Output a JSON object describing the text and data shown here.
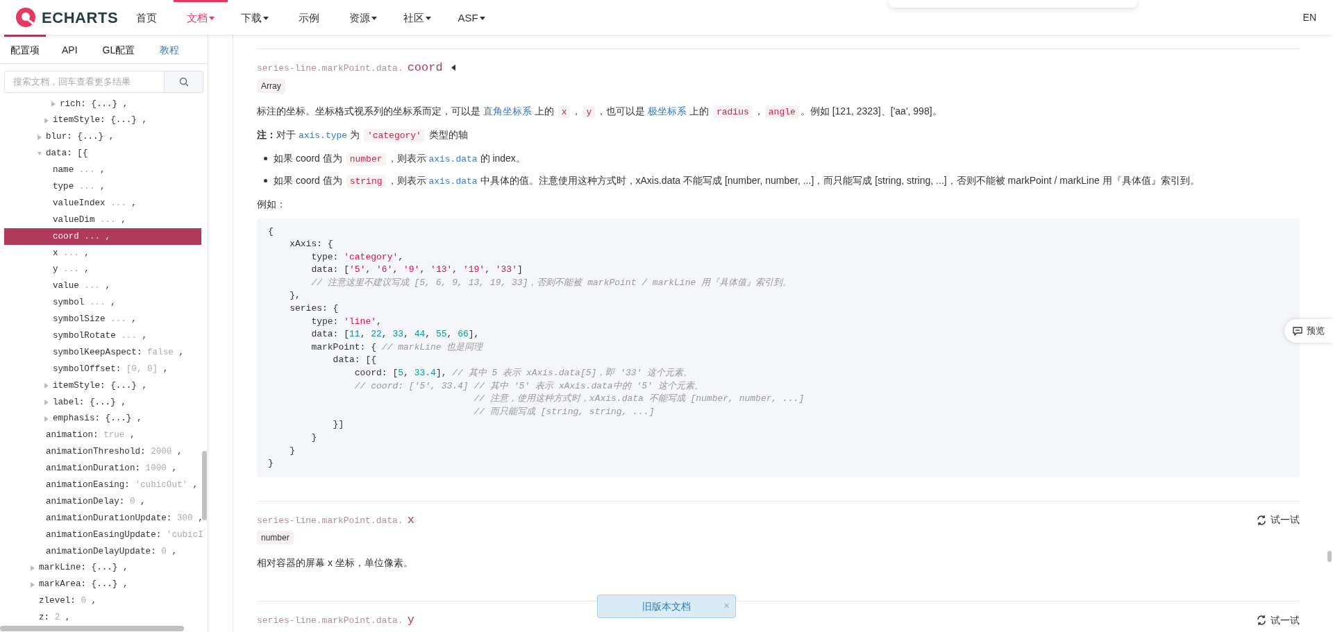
{
  "header": {
    "logo_text": "ECHARTS",
    "nav": [
      {
        "label": "首页",
        "selected": false,
        "has_menu": false
      },
      {
        "label": "文档",
        "selected": true,
        "has_menu": true
      },
      {
        "label": "下载",
        "selected": false,
        "has_menu": true
      },
      {
        "label": "示例",
        "selected": false,
        "has_menu": false
      },
      {
        "label": "资源",
        "selected": false,
        "has_menu": true
      },
      {
        "label": "社区",
        "selected": false,
        "has_menu": true
      },
      {
        "label": "ASF",
        "selected": false,
        "has_menu": true
      }
    ],
    "language": "EN"
  },
  "sidebar": {
    "tabs": [
      {
        "label": "配置项",
        "selected": true,
        "kind": "tab"
      },
      {
        "label": "API",
        "selected": false,
        "kind": "tab"
      },
      {
        "label": "GL配置",
        "selected": false,
        "kind": "tab"
      },
      {
        "label": "教程",
        "selected": false,
        "kind": "link"
      }
    ],
    "search": {
      "placeholder": "搜索文档，回车查看更多结果"
    },
    "tree": [
      {
        "kind": "hidden",
        "children": [
          {
            "kind": "hidden",
            "children": [
              {
                "kind": "hidden",
                "children": [
                  {
                    "kind": "node",
                    "key": "rich:",
                    "value": "{...}",
                    "value_muted": false,
                    "punct": ",",
                    "expanded": false,
                    "selected": false
                  }
                ]
              },
              {
                "kind": "node",
                "key": "itemStyle:",
                "value": "{...}",
                "value_muted": false,
                "punct": ",",
                "expanded": false,
                "selected": false
              }
            ]
          },
          {
            "kind": "node",
            "key": "blur:",
            "value": "{...}",
            "value_muted": false,
            "punct": ",",
            "expanded": false,
            "selected": false
          },
          {
            "kind": "node",
            "key": "data:",
            "value": "[{",
            "value_muted": false,
            "expanded": true,
            "selected": false,
            "children": [
              {
                "kind": "leaf",
                "key": "name",
                "value": "...",
                "value_muted": true,
                "punct": ",",
                "selected": false
              },
              {
                "kind": "leaf",
                "key": "type",
                "value": "...",
                "value_muted": true,
                "punct": ",",
                "selected": false
              },
              {
                "kind": "leaf",
                "key": "valueIndex",
                "value": "...",
                "value_muted": true,
                "punct": ",",
                "selected": false
              },
              {
                "kind": "leaf",
                "key": "valueDim",
                "value": "...",
                "value_muted": true,
                "punct": ",",
                "selected": false
              },
              {
                "kind": "leaf",
                "key": "coord",
                "value": "...",
                "value_muted": true,
                "punct": ",",
                "selected": true
              },
              {
                "kind": "leaf",
                "key": "x",
                "value": "...",
                "value_muted": true,
                "punct": ",",
                "selected": false
              },
              {
                "kind": "leaf",
                "key": "y",
                "value": "...",
                "value_muted": true,
                "punct": ",",
                "selected": false
              },
              {
                "kind": "leaf",
                "key": "value",
                "value": "...",
                "value_muted": true,
                "punct": ",",
                "selected": false
              },
              {
                "kind": "leaf",
                "key": "symbol",
                "value": "...",
                "value_muted": true,
                "punct": ",",
                "selected": false
              },
              {
                "kind": "leaf",
                "key": "symbolSize",
                "value": "...",
                "value_muted": true,
                "punct": ",",
                "selected": false
              },
              {
                "kind": "leaf",
                "key": "symbolRotate",
                "value": "...",
                "value_muted": true,
                "punct": ",",
                "selected": false
              },
              {
                "kind": "leaf",
                "key": "symbolKeepAspect:",
                "value": "false",
                "value_muted": true,
                "punct": ",",
                "selected": false
              },
              {
                "kind": "leaf",
                "key": "symbolOffset:",
                "value": "[0, 0]",
                "value_muted": true,
                "punct": ",",
                "selected": false
              },
              {
                "kind": "node",
                "key": "itemStyle:",
                "value": "{...}",
                "value_muted": false,
                "punct": ",",
                "expanded": false,
                "selected": false
              },
              {
                "kind": "node",
                "key": "label:",
                "value": "{...}",
                "value_muted": false,
                "punct": ",",
                "expanded": false,
                "selected": false
              },
              {
                "kind": "node",
                "key": "emphasis:",
                "value": "{...}",
                "value_muted": false,
                "punct": ",",
                "expanded": false,
                "selected": false
              }
            ]
          },
          {
            "kind": "leaf",
            "key": "animation:",
            "value": "true",
            "value_muted": true,
            "punct": ",",
            "selected": false
          },
          {
            "kind": "leaf",
            "key": "animationThreshold:",
            "value": "2000",
            "value_muted": true,
            "punct": ",",
            "selected": false
          },
          {
            "kind": "leaf",
            "key": "animationDuration:",
            "value": "1000",
            "value_muted": true,
            "punct": ",",
            "selected": false
          },
          {
            "kind": "leaf",
            "key": "animationEasing:",
            "value": "'cubicOut'",
            "value_muted": true,
            "punct": ",",
            "selected": false
          },
          {
            "kind": "leaf",
            "key": "animationDelay:",
            "value": "0",
            "value_muted": true,
            "punct": ",",
            "selected": false
          },
          {
            "kind": "leaf",
            "key": "animationDurationUpdate:",
            "value": "300",
            "value_muted": true,
            "punct": ",",
            "selected": false
          },
          {
            "kind": "leaf",
            "key": "animationEasingUpdate:",
            "value": "'cubicI",
            "value_muted": true,
            "selected": false
          },
          {
            "kind": "leaf",
            "key": "animationDelayUpdate:",
            "value": "0",
            "value_muted": true,
            "punct": ",",
            "selected": false
          }
        ]
      },
      {
        "kind": "node",
        "key": "markLine:",
        "value": "{...}",
        "value_muted": false,
        "punct": ",",
        "expanded": false,
        "selected": false
      },
      {
        "kind": "node",
        "key": "markArea:",
        "value": "{...}",
        "value_muted": false,
        "punct": ",",
        "expanded": false,
        "selected": false
      },
      {
        "kind": "leaf",
        "key": "zlevel:",
        "value": "0",
        "value_muted": true,
        "punct": ",",
        "selected": false
      },
      {
        "kind": "leaf",
        "key": "z:",
        "value": "2",
        "value_muted": true,
        "punct": ",",
        "selected": false
      }
    ]
  },
  "sections": [
    {
      "path": "series-line.markPoint.data.",
      "name": "coord",
      "toggle": true,
      "type": "Array",
      "blocks": [
        {
          "kind": "paragraph",
          "segments": [
            {
              "kind": "text",
              "text": "标注的坐标。坐标格式视系列的坐标系而定，可以是 "
            },
            {
              "kind": "link",
              "text": "直角坐标系"
            },
            {
              "kind": "text",
              "text": " 上的 "
            },
            {
              "kind": "code",
              "text": "x"
            },
            {
              "kind": "text",
              "text": "，"
            },
            {
              "kind": "code",
              "text": "y"
            },
            {
              "kind": "text",
              "text": "，也可以是 "
            },
            {
              "kind": "link",
              "text": "极坐标系"
            },
            {
              "kind": "text",
              "text": " 上的 "
            },
            {
              "kind": "code",
              "text": "radius"
            },
            {
              "kind": "text",
              "text": "，"
            },
            {
              "kind": "code",
              "text": "angle"
            },
            {
              "kind": "text",
              "text": "。例如 [121, 2323]、['aa', 998]。"
            }
          ]
        },
        {
          "kind": "paragraph",
          "segments": [
            {
              "kind": "bold",
              "text": "注："
            },
            {
              "kind": "text",
              "text": "对于 "
            },
            {
              "kind": "code_link",
              "text": "axis.type"
            },
            {
              "kind": "text",
              "text": " 为 "
            },
            {
              "kind": "code",
              "text": "'category'"
            },
            {
              "kind": "text",
              "text": " 类型的轴"
            }
          ]
        },
        {
          "kind": "bullets",
          "items": [
            [
              {
                "kind": "text",
                "text": "如果 coord 值为 "
              },
              {
                "kind": "code",
                "text": "number"
              },
              {
                "kind": "text",
                "text": "，则表示 "
              },
              {
                "kind": "code_link",
                "text": "axis.data"
              },
              {
                "kind": "text",
                "text": " 的 index。"
              }
            ],
            [
              {
                "kind": "text",
                "text": "如果 coord 值为 "
              },
              {
                "kind": "code",
                "text": "string"
              },
              {
                "kind": "text",
                "text": "，则表示 "
              },
              {
                "kind": "code_link",
                "text": "axis.data"
              },
              {
                "kind": "text",
                "text": " 中具体的值。注意使用这种方式时，xAxis.data 不能写成 [number, number, ...]，而只能写成 [string, string, ...]，否则不能被 markPoint / markLine 用『具体值』索引到。"
              }
            ]
          ]
        },
        {
          "kind": "paragraph",
          "segments": [
            {
              "kind": "text",
              "text": "例如："
            }
          ]
        },
        {
          "kind": "code",
          "lines": [
            [
              {
                "kind": "plain",
                "text": "{"
              }
            ],
            [
              {
                "kind": "plain",
                "text": "    xAxis: {"
              }
            ],
            [
              {
                "kind": "plain",
                "text": "        type: "
              },
              {
                "kind": "string",
                "text": "'category'"
              },
              {
                "kind": "plain",
                "text": ","
              }
            ],
            [
              {
                "kind": "plain",
                "text": "        data: ["
              },
              {
                "kind": "string",
                "text": "'5'"
              },
              {
                "kind": "plain",
                "text": ", "
              },
              {
                "kind": "string",
                "text": "'6'"
              },
              {
                "kind": "plain",
                "text": ", "
              },
              {
                "kind": "string",
                "text": "'9'"
              },
              {
                "kind": "plain",
                "text": ", "
              },
              {
                "kind": "string",
                "text": "'13'"
              },
              {
                "kind": "plain",
                "text": ", "
              },
              {
                "kind": "string",
                "text": "'19'"
              },
              {
                "kind": "plain",
                "text": ", "
              },
              {
                "kind": "string",
                "text": "'33'"
              },
              {
                "kind": "plain",
                "text": "]"
              }
            ],
            [
              {
                "kind": "comment",
                "text": "        // 注意这里不建议写成 [5, 6, 9, 13, 19, 33]，否则不能被 markPoint / markLine 用『具体值』索引到。"
              }
            ],
            [
              {
                "kind": "plain",
                "text": "    },"
              }
            ],
            [
              {
                "kind": "plain",
                "text": "    series: {"
              }
            ],
            [
              {
                "kind": "plain",
                "text": "        type: "
              },
              {
                "kind": "string",
                "text": "'line'"
              },
              {
                "kind": "plain",
                "text": ","
              }
            ],
            [
              {
                "kind": "plain",
                "text": "        data: ["
              },
              {
                "kind": "number",
                "text": "11"
              },
              {
                "kind": "plain",
                "text": ", "
              },
              {
                "kind": "number",
                "text": "22"
              },
              {
                "kind": "plain",
                "text": ", "
              },
              {
                "kind": "number",
                "text": "33"
              },
              {
                "kind": "plain",
                "text": ", "
              },
              {
                "kind": "number",
                "text": "44"
              },
              {
                "kind": "plain",
                "text": ", "
              },
              {
                "kind": "number",
                "text": "55"
              },
              {
                "kind": "plain",
                "text": ", "
              },
              {
                "kind": "number",
                "text": "66"
              },
              {
                "kind": "plain",
                "text": "],"
              }
            ],
            [
              {
                "kind": "plain",
                "text": "        markPoint: { "
              },
              {
                "kind": "comment",
                "text": "// markLine 也是同理"
              }
            ],
            [
              {
                "kind": "plain",
                "text": "            data: [{"
              }
            ],
            [
              {
                "kind": "plain",
                "text": "                coord: ["
              },
              {
                "kind": "number",
                "text": "5"
              },
              {
                "kind": "plain",
                "text": ", "
              },
              {
                "kind": "number",
                "text": "33.4"
              },
              {
                "kind": "plain",
                "text": "], "
              },
              {
                "kind": "comment",
                "text": "// 其中 5 表示 xAxis.data[5]，即 '33' 这个元素。"
              }
            ],
            [
              {
                "kind": "comment",
                "text": "                // coord: ['5', 33.4] // 其中 '5' 表示 xAxis.data中的 '5' 这个元素。"
              }
            ],
            [
              {
                "kind": "comment",
                "text": "                                      // 注意，使用这种方式时，xAxis.data 不能写成 [number, number, ...]"
              }
            ],
            [
              {
                "kind": "comment",
                "text": "                                      // 而只能写成 [string, string, ...]"
              }
            ],
            [
              {
                "kind": "plain",
                "text": "            }]"
              }
            ],
            [
              {
                "kind": "plain",
                "text": "        }"
              }
            ],
            [
              {
                "kind": "plain",
                "text": "    }"
              }
            ],
            [
              {
                "kind": "plain",
                "text": "}"
              }
            ]
          ]
        }
      ]
    },
    {
      "path": "series-line.markPoint.data.",
      "name": "x",
      "toggle": false,
      "try_label": "试一试",
      "type": "number",
      "blocks": [
        {
          "kind": "paragraph",
          "segments": [
            {
              "kind": "text",
              "text": "相对容器的屏幕 x 坐标，单位像素。"
            }
          ]
        }
      ]
    },
    {
      "path": "series-line.markPoint.data.",
      "name": "y",
      "toggle": false,
      "try_label": "试一试"
    }
  ],
  "preview_button": "预览",
  "old_docs_toast": {
    "label": "旧版本文档",
    "close": "×"
  }
}
